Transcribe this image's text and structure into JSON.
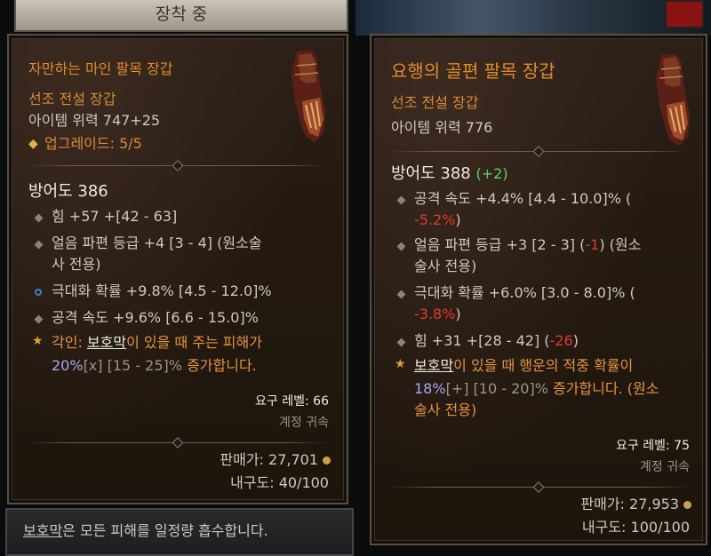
{
  "equipped_label": "장착 중",
  "left": {
    "name": "자만하는 마인 팔목 장갑",
    "type": "선조 전설 장갑",
    "item_power": "아이템 위력 747+25",
    "upgrade": "업그레이드: 5/5",
    "armor": "방어도 386",
    "stats": [
      "힘 +57 +[42 - 63]",
      "얼음 파편 등급 +4 [3 - 4] (원소술",
      "사 전용)",
      "극대화 확률 +9.8% [4.5 - 12.0]%",
      "공격 속도 +9.6% [6.6 - 15.0]%"
    ],
    "aspect_prefix": "각인: ",
    "aspect_keyword": "보호막",
    "aspect_line1": "이 있을 때 주는 피해가",
    "aspect_value": "20%",
    "aspect_bracket": "[x]",
    "aspect_range": "[15 - 25]%",
    "aspect_line2": "증가합니다.",
    "req_level": "요구 레벨: 66",
    "bound": "계정 귀속",
    "sell": "판매가: 27,701",
    "durability": "내구도: 40/100"
  },
  "right": {
    "name": "요행의 골편 팔목 장갑",
    "type": "선조 전설 장갑",
    "item_power": "아이템 위력 776",
    "armor": "방어도 388",
    "armor_diff": "(+2)",
    "stat1_a": "공격 속도 +4.4% [4.4 - 10.0]% (",
    "stat1_b": "-5.2%",
    "stat1_c": ")",
    "stat2_a": "얼음 파편 등급 +3 [2 - 3] (",
    "stat2_b": "-1",
    "stat2_c": ") (원소",
    "stat2_d": "술사 전용)",
    "stat3_a": "극대화 확률 +6.0% [3.0 - 8.0]% (",
    "stat3_b": "-3.8%",
    "stat3_c": ")",
    "stat4_a": "힘 +31 +[28 - 42] (",
    "stat4_b": "-26",
    "stat4_c": ")",
    "aspect_keyword": "보호막",
    "aspect_line1": "이 있을 때 행운의 적중 확률이",
    "aspect_value": "18%",
    "aspect_bracket": "[+]",
    "aspect_range": "[10 - 20]%",
    "aspect_line2": "증가합니다. (원소",
    "aspect_line3": "술사 전용)",
    "req_level": "요구 레벨: 75",
    "bound": "계정 귀속",
    "sell": "판매가: 27,953",
    "durability": "내구도: 100/100"
  },
  "footer": {
    "keyword": "보호막",
    "text": "은 모든 피해를 일정량 흡수합니다."
  },
  "colors": {
    "legendary": "#e08a2a",
    "positive": "#5fd35f",
    "negative": "#e03a2e",
    "aspect_value": "#a7a9f0"
  }
}
